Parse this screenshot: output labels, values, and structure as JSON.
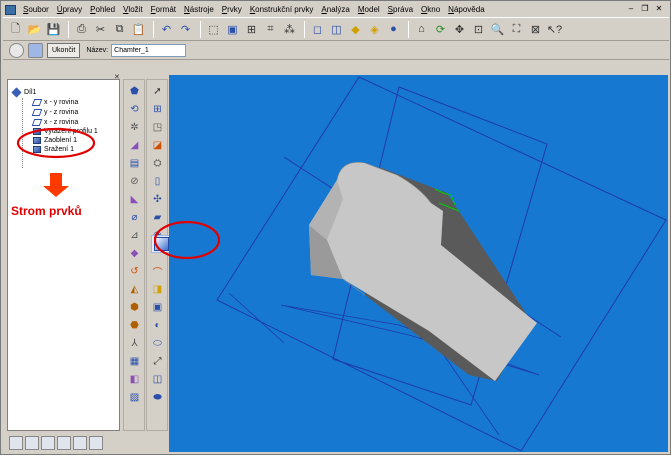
{
  "menu": {
    "items": [
      "Soubor",
      "Úpravy",
      "Pohled",
      "Vložit",
      "Formát",
      "Nástroje",
      "Prvky",
      "Konstrukční prvky",
      "Analýza",
      "Model",
      "Správa",
      "Okno",
      "Nápověda"
    ]
  },
  "feature_bar": {
    "finish_label": "Ukončit",
    "name_label": "Název:",
    "name_value": "Chamfer_1"
  },
  "tree": {
    "root": "Díl1",
    "items": [
      "x - y rovina",
      "y - z rovina",
      "x - z rovina",
      "Vytažení profilu 1",
      "Zaoblení 1",
      "Sražení 1"
    ]
  },
  "annotation": {
    "label": "Strom prvků",
    "color": "#e00000"
  },
  "colors": {
    "viewport_bg": "#1778d1",
    "plane_line": "#1e3aa8",
    "model_light": "#c7c7c7",
    "model_dark": "#5a5a5a",
    "highlight": "#e00000",
    "dimension": "#00d000"
  }
}
